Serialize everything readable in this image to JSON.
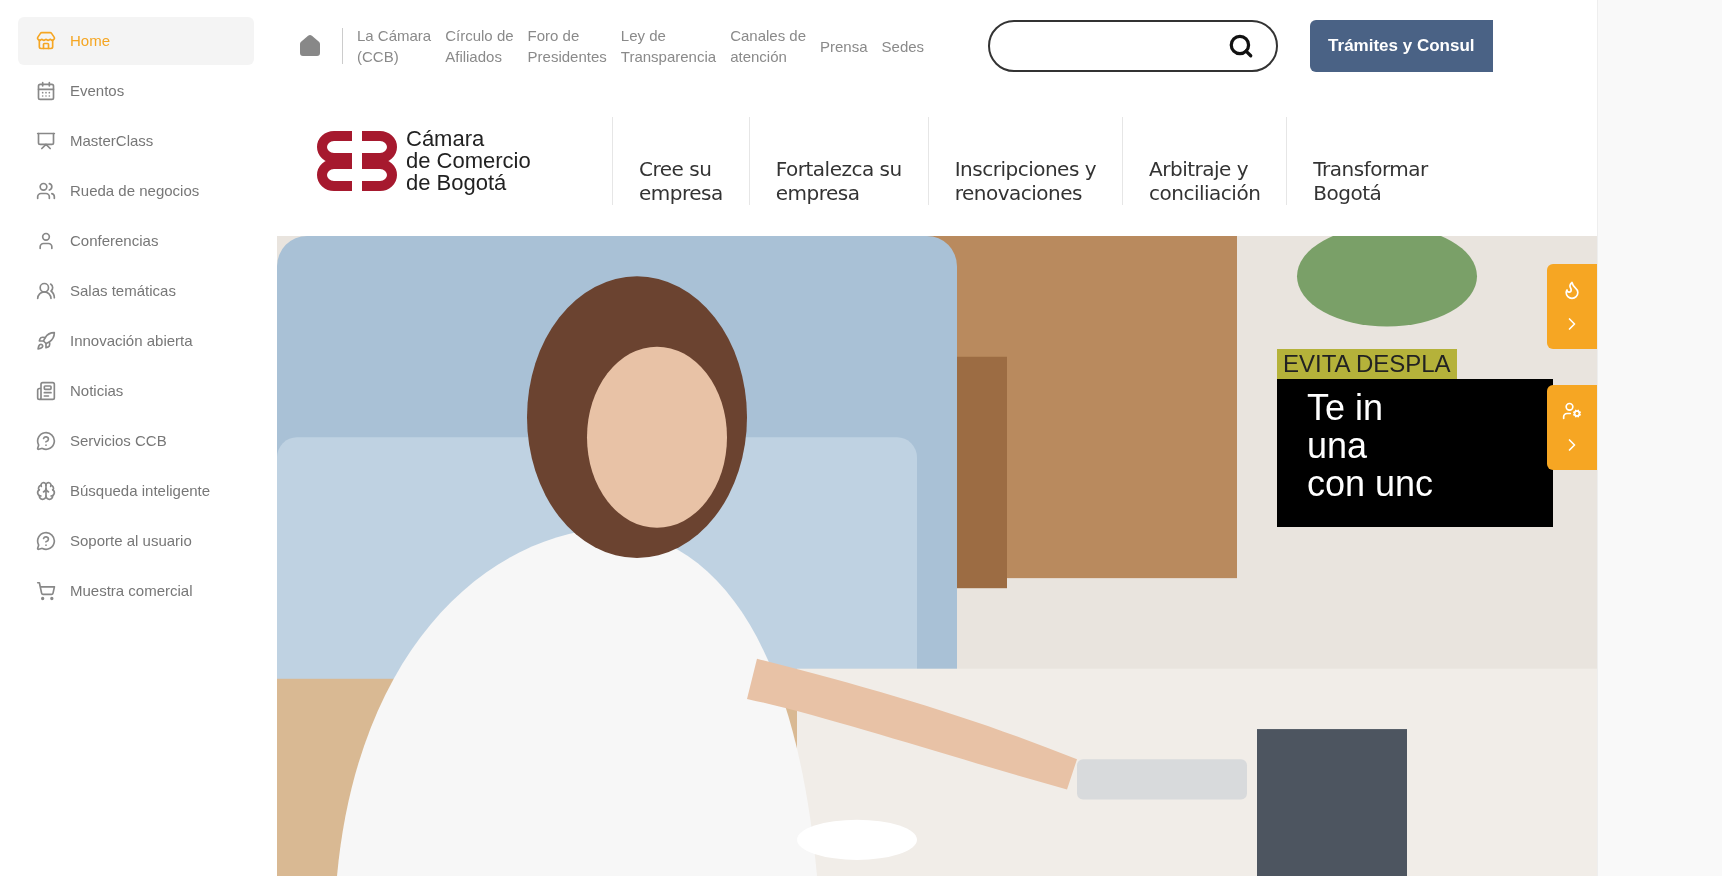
{
  "sidebar": {
    "items": [
      {
        "label": "Home",
        "selected": true
      },
      {
        "label": "Eventos",
        "selected": false
      },
      {
        "label": "MasterClass",
        "selected": false
      },
      {
        "label": "Rueda de negocios",
        "selected": false
      },
      {
        "label": "Conferencias",
        "selected": false
      },
      {
        "label": "Salas temáticas",
        "selected": false
      },
      {
        "label": "Innovación abierta",
        "selected": false
      },
      {
        "label": "Noticias",
        "selected": false
      },
      {
        "label": "Servicios CCB",
        "selected": false
      },
      {
        "label": "Búsqueda inteligente",
        "selected": false
      },
      {
        "label": "Soporte al usuario",
        "selected": false
      },
      {
        "label": "Muestra comercial",
        "selected": false
      }
    ]
  },
  "top_links": [
    {
      "lines": [
        "La Cámara",
        "(CCB)"
      ]
    },
    {
      "lines": [
        "Círculo de",
        "Afiliados"
      ]
    },
    {
      "lines": [
        "Foro de",
        "Presidentes"
      ]
    },
    {
      "lines": [
        "Ley de",
        "Transparencia"
      ]
    },
    {
      "lines": [
        "Canales de",
        "atención"
      ]
    },
    {
      "lines": [
        "Prensa"
      ]
    },
    {
      "lines": [
        "Sedes"
      ]
    }
  ],
  "cta_button": "Trámites y Consul",
  "logo": {
    "lines": [
      "Cámara",
      "de Comercio",
      "de Bogotá"
    ]
  },
  "main_menu": [
    {
      "lines": [
        "Cree su",
        "empresa"
      ]
    },
    {
      "lines": [
        "Fortalezca su",
        "empresa"
      ]
    },
    {
      "lines": [
        "Inscripciones y",
        "renovaciones"
      ]
    },
    {
      "lines": [
        "Arbitraje y",
        "conciliación"
      ]
    },
    {
      "lines": [
        "Transformar",
        "Bogotá"
      ]
    }
  ],
  "hero": {
    "kind": "picture",
    "tag": "EVITA DESPLA",
    "lines": [
      "Te in",
      "una",
      "con unc"
    ]
  }
}
